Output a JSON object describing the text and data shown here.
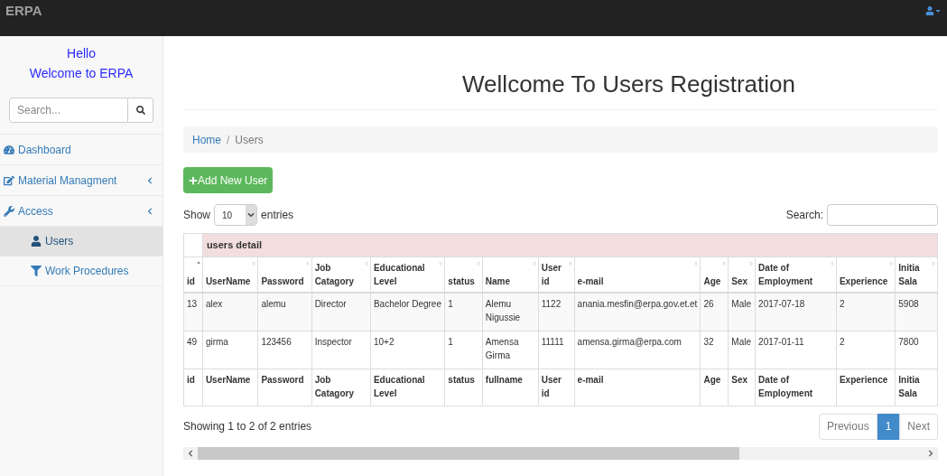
{
  "navbar": {
    "brand": "ERPA"
  },
  "sidebar": {
    "greeting": "Hello",
    "welcome": "Welcome to ERPA",
    "search": {
      "placeholder": "Search..."
    },
    "items": [
      {
        "label": "Dashboard",
        "selected": false,
        "expandable": false
      },
      {
        "label": "Material Managment",
        "selected": false,
        "expandable": true
      },
      {
        "label": "Access",
        "selected": false,
        "expandable": true,
        "children": [
          {
            "label": "Users",
            "selected": true
          },
          {
            "label": "Work Procedures",
            "selected": false
          }
        ]
      }
    ]
  },
  "page": {
    "title": "Wellcome To Users Registration",
    "breadcrumb": [
      {
        "label": "Home",
        "link": true
      },
      {
        "label": "Users",
        "link": false
      }
    ],
    "breadcrumb_separator": "/",
    "add_button": "Add New User",
    "length": {
      "show": "Show",
      "value": "10",
      "entries": "entries"
    },
    "search_label": "Search:",
    "table": {
      "group_header": "users detail",
      "columns": [
        {
          "label": "id",
          "sorted": true
        },
        {
          "label": "UserName",
          "sorted": false
        },
        {
          "label": "Password",
          "sorted": false
        },
        {
          "label": "Job Catagory",
          "sorted": false
        },
        {
          "label": "Educational Level",
          "sorted": false
        },
        {
          "label": "status",
          "sorted": false
        },
        {
          "label": "Name",
          "sorted": false
        },
        {
          "label": "User id",
          "sorted": false
        },
        {
          "label": "e-mail",
          "sorted": false
        },
        {
          "label": "Age",
          "sorted": false
        },
        {
          "label": "Sex",
          "sorted": false
        },
        {
          "label": "Date of Employment",
          "sorted": false
        },
        {
          "label": "Experience",
          "sorted": false
        },
        {
          "label": "Initia Sala",
          "sorted": false
        }
      ],
      "rows": [
        [
          "13",
          "alex",
          "alemu",
          "Director",
          "Bachelor Degree",
          "1",
          "Alemu Nigussie",
          "1122",
          "anania.mesfin@erpa.gov.et.et",
          "26",
          "Male",
          "2017-07-18",
          "2",
          "5908"
        ],
        [
          "49",
          "girma",
          "123456",
          "Inspector",
          "10+2",
          "1",
          "Amensa Girma",
          "11111",
          "amensa.girma@erpa.com",
          "32",
          "Male",
          "2017-01-11",
          "2",
          "7800"
        ]
      ],
      "footer": [
        "id",
        "UserName",
        "Password",
        "Job Catagory",
        "Educational Level",
        "status",
        "fullname",
        "User id",
        "e-mail",
        "Age",
        "Sex",
        "Date of Employment",
        "Experience",
        "Initia Sala"
      ]
    },
    "info": "Showing 1 to 2 of 2 entries",
    "pagination": [
      {
        "label": "Previous",
        "selected": false
      },
      {
        "label": "1",
        "selected": true
      },
      {
        "label": "Next",
        "selected": false
      }
    ]
  }
}
